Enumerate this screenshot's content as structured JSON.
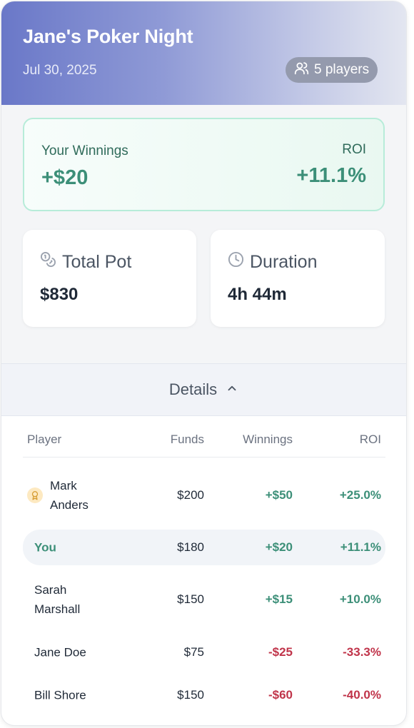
{
  "header": {
    "title": "Jane's Poker Night",
    "date": "Jul 30, 2025",
    "players_badge": "5 players"
  },
  "winnings": {
    "label": "Your Winnings",
    "value": "+$20",
    "roi_label": "ROI",
    "roi_value": "+11.1%"
  },
  "stats": {
    "total_pot": {
      "label": "Total Pot",
      "value": "$830"
    },
    "duration": {
      "label": "Duration",
      "value": "4h 44m"
    }
  },
  "details": {
    "label": "Details"
  },
  "table": {
    "headers": {
      "player": "Player",
      "funds": "Funds",
      "winnings": "Winnings",
      "roi": "ROI"
    },
    "rows": [
      {
        "player_line1": "Mark",
        "player_line2": "Anders",
        "funds": "$200",
        "winnings": "+$50",
        "roi": "+25.0%"
      },
      {
        "player_line1": "You",
        "player_line2": "",
        "funds": "$180",
        "winnings": "+$20",
        "roi": "+11.1%"
      },
      {
        "player_line1": "Sarah",
        "player_line2": "Marshall",
        "funds": "$150",
        "winnings": "+$15",
        "roi": "+10.0%"
      },
      {
        "player_line1": "Jane Doe",
        "player_line2": "",
        "funds": "$75",
        "winnings": "-$25",
        "roi": "-33.3%"
      },
      {
        "player_line1": "Bill Shore",
        "player_line2": "",
        "funds": "$150",
        "winnings": "-$60",
        "roi": "-40.0%"
      }
    ]
  },
  "colors": {
    "positive": "#3c8f78",
    "negative": "#c0344a",
    "header_start": "#6a78c8",
    "medal_bg": "#fde9c1"
  }
}
